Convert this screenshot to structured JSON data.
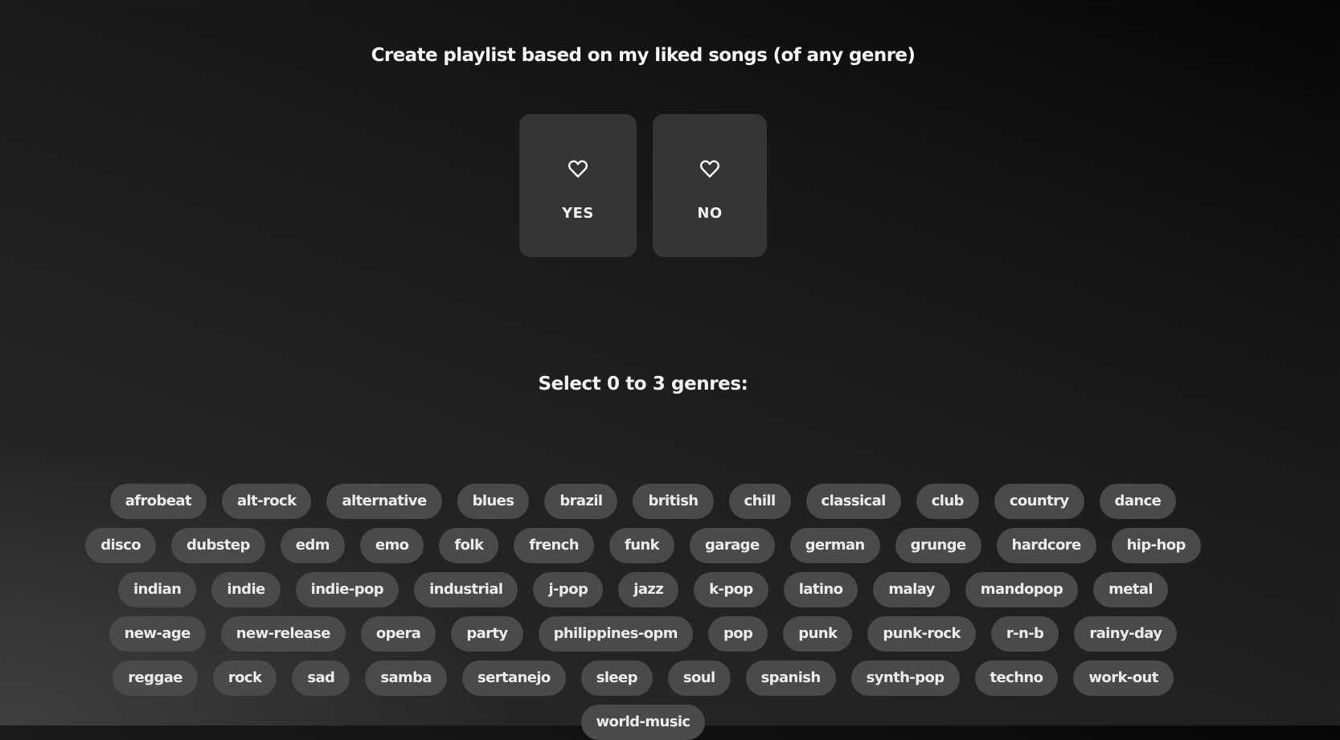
{
  "title": "Create playlist based on my liked songs (of any genre)",
  "choices": [
    {
      "label": "YES",
      "icon": "heart-outline-icon"
    },
    {
      "label": "NO",
      "icon": "heart-outline-icon"
    }
  ],
  "genre_prompt": "Select 0 to 3 genres:",
  "genres": [
    "afrobeat",
    "alt-rock",
    "alternative",
    "blues",
    "brazil",
    "british",
    "chill",
    "classical",
    "club",
    "country",
    "dance",
    "disco",
    "dubstep",
    "edm",
    "emo",
    "folk",
    "french",
    "funk",
    "garage",
    "german",
    "grunge",
    "hardcore",
    "hip-hop",
    "indian",
    "indie",
    "indie-pop",
    "industrial",
    "j-pop",
    "jazz",
    "k-pop",
    "latino",
    "malay",
    "mandopop",
    "metal",
    "new-age",
    "new-release",
    "opera",
    "party",
    "philippines-opm",
    "pop",
    "punk",
    "punk-rock",
    "r-n-b",
    "rainy-day",
    "reggae",
    "rock",
    "sad",
    "samba",
    "sertanejo",
    "sleep",
    "soul",
    "spanish",
    "synth-pop",
    "techno",
    "work-out",
    "world-music"
  ],
  "colors": {
    "card_bg": "#353535",
    "chip_bg": "#4a4a4a",
    "text": "#ffffff"
  }
}
